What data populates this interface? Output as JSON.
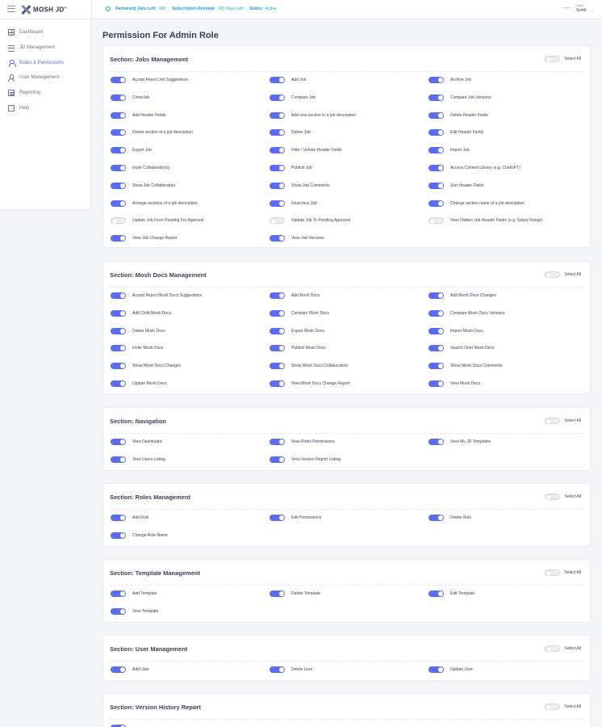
{
  "header": {
    "logo_text": "MOSH JD",
    "logo_mark": "®",
    "status": [
      {
        "label": "Remaining Jobs Left:",
        "value": "435"
      },
      {
        "label": "Subscription Renewal:",
        "value": "142 Days Left"
      },
      {
        "label": "Status:",
        "value": "Active"
      }
    ],
    "user_role": "Grant",
    "user_name": "Smith",
    "avatar_text": "hyperlogo"
  },
  "sidebar": {
    "items": [
      {
        "label": "Dashboard",
        "icon": "dashboard-icon",
        "active": false
      },
      {
        "label": "JD Management",
        "icon": "list-icon",
        "active": false
      },
      {
        "label": "Roles & Permissions",
        "icon": "roles-icon",
        "active": true
      },
      {
        "label": "User Management",
        "icon": "user-icon",
        "active": false
      },
      {
        "label": "Reporting",
        "icon": "report-icon",
        "active": false
      },
      {
        "label": "Help",
        "icon": "help-icon",
        "active": false
      }
    ]
  },
  "page": {
    "title": "Permission For Admin Role",
    "select_all_label": "Select All"
  },
  "sections": [
    {
      "title": "Section: Jobs Management",
      "select_all_on": false,
      "permissions": [
        {
          "label": "Accept Reject Job Suggestions",
          "on": true
        },
        {
          "label": "Add Job",
          "on": true
        },
        {
          "label": "Archive Job",
          "on": true
        },
        {
          "label": "CloneJob",
          "on": true
        },
        {
          "label": "Compare Job",
          "on": true
        },
        {
          "label": "Compare Job Versions",
          "on": true
        },
        {
          "label": "Add Header Fields",
          "on": true
        },
        {
          "label": "Add new section to a job description",
          "on": true
        },
        {
          "label": "Delete Header Fields",
          "on": true
        },
        {
          "label": "Delete section of a job description",
          "on": true
        },
        {
          "label": "Delete Job",
          "on": true
        },
        {
          "label": "Edit Header Fields",
          "on": true
        },
        {
          "label": "Export Job",
          "on": true
        },
        {
          "label": "Hide / Unhide Header Fields",
          "on": true
        },
        {
          "label": "Import Job",
          "on": true
        },
        {
          "label": "Invite Collaborator(s)",
          "on": true
        },
        {
          "label": "Publish Job",
          "on": true
        },
        {
          "label": "Access Content Library (e.g. ChatGPT)",
          "on": true
        },
        {
          "label": "Show Job Collaborators",
          "on": true
        },
        {
          "label": "Show Job Comments",
          "on": true
        },
        {
          "label": "Sort Header Fields",
          "on": true
        },
        {
          "label": "Arrange sections of a job description",
          "on": true
        },
        {
          "label": "Unarchive Job",
          "on": true
        },
        {
          "label": "Change section name of a job description",
          "on": true
        },
        {
          "label": "Update Job From Pending For Approval",
          "on": false
        },
        {
          "label": "Update Job To Pending Approval",
          "on": false
        },
        {
          "label": "View Hidden Job Header Fields (e.g. Salary Range)",
          "on": false
        },
        {
          "label": "View Job Change Report",
          "on": true
        },
        {
          "label": "View Job Versions",
          "on": true
        }
      ]
    },
    {
      "title": "Section: Mosh Docs Management",
      "select_all_on": false,
      "permissions": [
        {
          "label": "Accept Reject Mosh Docs Suggestions",
          "on": true
        },
        {
          "label": "Add Mosh Docs",
          "on": true
        },
        {
          "label": "Add Mosh Docs Changes",
          "on": true
        },
        {
          "label": "Add Child Mosh Docs",
          "on": true
        },
        {
          "label": "Compare Mosh Docs",
          "on": true
        },
        {
          "label": "Compare Mosh Docs Versions",
          "on": true
        },
        {
          "label": "Delete Mosh Docs",
          "on": true
        },
        {
          "label": "Export Mosh Docs",
          "on": true
        },
        {
          "label": "Import Mosh Docs",
          "on": true
        },
        {
          "label": "Invite Mosh Docs",
          "on": true
        },
        {
          "label": "Publish Mosh Docs",
          "on": true
        },
        {
          "label": "Search Onet Mosh Docs",
          "on": true
        },
        {
          "label": "Show Mosh Docs Changes",
          "on": true
        },
        {
          "label": "Show Mosh Docs Collaborators",
          "on": true
        },
        {
          "label": "Show Mosh Docs Comments",
          "on": true
        },
        {
          "label": "Update Mosh Docs",
          "on": true
        },
        {
          "label": "View Mosh Docs Change Report",
          "on": true
        },
        {
          "label": "View Mosh Docs",
          "on": true
        }
      ]
    },
    {
      "title": "Section: Navigation",
      "select_all_on": false,
      "permissions": [
        {
          "label": "View Dashboard",
          "on": true
        },
        {
          "label": "View Roles Permissions",
          "on": true
        },
        {
          "label": "View My JD Templates",
          "on": true
        },
        {
          "label": "View Users Listing",
          "on": true
        },
        {
          "label": "View Version Report Listing",
          "on": true
        }
      ]
    },
    {
      "title": "Section: Roles Management",
      "select_all_on": false,
      "permissions": [
        {
          "label": "Add Role",
          "on": true
        },
        {
          "label": "Edit Permissions",
          "on": true
        },
        {
          "label": "Delete Role",
          "on": true
        },
        {
          "label": "Change Role Name",
          "on": true
        }
      ]
    },
    {
      "title": "Section: Template Management",
      "select_all_on": false,
      "permissions": [
        {
          "label": "Add Template",
          "on": true
        },
        {
          "label": "Delete Template",
          "on": true
        },
        {
          "label": "Edit Template",
          "on": true
        },
        {
          "label": "View Template",
          "on": true
        }
      ]
    },
    {
      "title": "Section: User Management",
      "select_all_on": false,
      "permissions": [
        {
          "label": "Add User",
          "on": true
        },
        {
          "label": "Delete User",
          "on": true
        },
        {
          "label": "Update User",
          "on": true
        }
      ]
    },
    {
      "title": "Section: Version History Report",
      "select_all_on": false,
      "permissions": [
        {
          "label": "",
          "on": true
        }
      ]
    }
  ]
}
